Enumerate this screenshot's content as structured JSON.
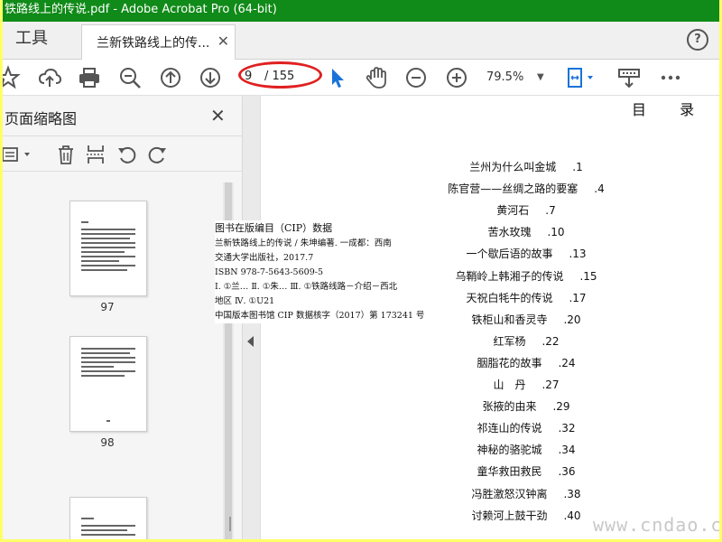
{
  "window": {
    "title": "铁路线上的传说.pdf - Adobe Acrobat Pro (64-bit)"
  },
  "tabs": {
    "tools": "工具",
    "document": "兰新铁路线上的传...",
    "close": "✕",
    "help": "?"
  },
  "toolbar": {
    "page_current": "9",
    "page_total": "/ 155",
    "zoom": "79.5%",
    "zoom_arrow": "▼",
    "icons": [
      "star-icon",
      "cloud-upload-icon",
      "print-icon",
      "zoom-search-icon",
      "page-up-icon",
      "page-down-icon",
      "select-arrow-icon",
      "hand-icon",
      "zoom-out-icon",
      "zoom-in-icon",
      "fit-page-icon",
      "comment-stamp-icon",
      "more-icon"
    ],
    "accent": "#1a73d9"
  },
  "left_pane": {
    "title": "页面缩略图",
    "close": "✕",
    "thumbnails": [
      {
        "label": "97"
      },
      {
        "label": "98"
      },
      {
        "label": ""
      }
    ]
  },
  "cip": {
    "heading": "图书在版编目（CIP）数据",
    "lines": [
      "兰新铁路线上的传说 / 朱坤编著. 一成都：西南",
      "交通大学出版社，2017.7",
      "ISBN 978-7-5643-5609-5",
      "Ⅰ. ①兰… Ⅱ. ①朱… Ⅲ. ①铁路线路－介绍－西北",
      "地区 Ⅳ. ①U21",
      "中国版本图书馆 CIP 数据核字（2017）第 173241 号"
    ]
  },
  "toc": {
    "heading": "目 录",
    "items": [
      {
        "title": "兰州为什么叫金城",
        "page": ".1"
      },
      {
        "title": "陈官营——丝绸之路的要塞",
        "page": ".4"
      },
      {
        "title": "黄河石",
        "page": ".7"
      },
      {
        "title": "苦水玫瑰",
        "page": ".10"
      },
      {
        "title": "一个歇后语的故事",
        "page": ".13"
      },
      {
        "title": "乌鞘岭上韩湘子的传说",
        "page": ".15"
      },
      {
        "title": "天祝白牦牛的传说",
        "page": ".17"
      },
      {
        "title": "铁柜山和香灵寺",
        "page": ".20"
      },
      {
        "title": "红军杨",
        "page": ".22"
      },
      {
        "title": "胭脂花的故事",
        "page": ".24"
      },
      {
        "title": "山　丹",
        "page": ".27"
      },
      {
        "title": "张掖的由来",
        "page": ".29"
      },
      {
        "title": "祁连山的传说",
        "page": ".32"
      },
      {
        "title": "神秘的骆驼城",
        "page": ".34"
      },
      {
        "title": "童华救田救民",
        "page": ".36"
      },
      {
        "title": "冯胜激怒汉钟离",
        "page": ".38"
      },
      {
        "title": "讨赖河上鼓干劲",
        "page": ".40"
      }
    ]
  },
  "watermark": "www.cndao.com"
}
